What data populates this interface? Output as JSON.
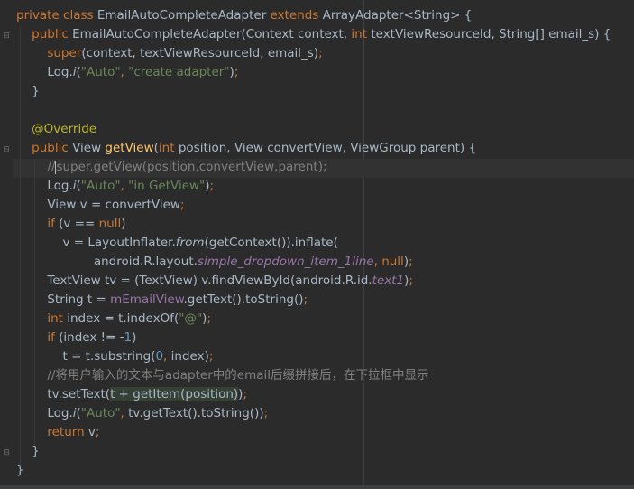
{
  "lines": [
    [
      {
        "t": "private class ",
        "c": "kw"
      },
      {
        "t": "EmailAutoCompleteAdapter "
      },
      {
        "t": "extends ",
        "c": "kw"
      },
      {
        "t": "ArrayAdapter<String> {"
      }
    ],
    [
      {
        "t": "    "
      },
      {
        "t": "public ",
        "c": "kw"
      },
      {
        "t": "EmailAutoCompleteAdapter(Context context, "
      },
      {
        "t": "int ",
        "c": "kw"
      },
      {
        "t": "textViewResourceId, String[] email_s) {"
      }
    ],
    [
      {
        "t": "        "
      },
      {
        "t": "super",
        "c": "kw"
      },
      {
        "t": "(context, textViewResourceId, email_s)"
      },
      {
        "t": ";",
        "c": "kw"
      }
    ],
    [
      {
        "t": "        Log."
      },
      {
        "t": "i",
        "c": "ital"
      },
      {
        "t": "("
      },
      {
        "t": "\"Auto\"",
        "c": "str"
      },
      {
        "t": ", ",
        "c": "kw"
      },
      {
        "t": "\"create adapter\"",
        "c": "str"
      },
      {
        "t": ")"
      },
      {
        "t": ";",
        "c": "kw"
      }
    ],
    [
      {
        "t": "    }"
      }
    ],
    [
      {
        "t": ""
      }
    ],
    [
      {
        "t": "    "
      },
      {
        "t": "@Override",
        "c": "ann"
      }
    ],
    [
      {
        "t": "    "
      },
      {
        "t": "public ",
        "c": "kw"
      },
      {
        "t": "View "
      },
      {
        "t": "getView",
        "c": "fn"
      },
      {
        "t": "("
      },
      {
        "t": "int ",
        "c": "kw"
      },
      {
        "t": "position, View convertView, ViewGroup parent) {"
      }
    ],
    [
      {
        "t": "        //",
        "c": "cmt"
      },
      {
        "t": "",
        "c": "caret"
      },
      {
        "t": "super.getView(position,convertView,parent);",
        "c": "cmt"
      }
    ],
    [
      {
        "t": "        Log."
      },
      {
        "t": "i",
        "c": "ital"
      },
      {
        "t": "("
      },
      {
        "t": "\"Auto\"",
        "c": "str"
      },
      {
        "t": ", ",
        "c": "kw"
      },
      {
        "t": "\"in GetView\"",
        "c": "str"
      },
      {
        "t": ")"
      },
      {
        "t": ";",
        "c": "kw"
      }
    ],
    [
      {
        "t": "        View v = convertView"
      },
      {
        "t": ";",
        "c": "kw"
      }
    ],
    [
      {
        "t": "        "
      },
      {
        "t": "if ",
        "c": "kw"
      },
      {
        "t": "(v == "
      },
      {
        "t": "null",
        "c": "kw"
      },
      {
        "t": ")"
      }
    ],
    [
      {
        "t": "            v = LayoutInflater."
      },
      {
        "t": "from",
        "c": "ital"
      },
      {
        "t": "(getContext()).inflate("
      }
    ],
    [
      {
        "t": "                    android.R.layout."
      },
      {
        "t": "simple_dropdown_item_1line",
        "c": "static"
      },
      {
        "t": ", ",
        "c": "kw"
      },
      {
        "t": "null",
        "c": "kw"
      },
      {
        "t": ")"
      },
      {
        "t": ";",
        "c": "kw"
      }
    ],
    [
      {
        "t": "        TextView tv = (TextView) v.findViewById(android.R.id."
      },
      {
        "t": "text1",
        "c": "static"
      },
      {
        "t": ")"
      },
      {
        "t": ";",
        "c": "kw"
      }
    ],
    [
      {
        "t": "        String t = "
      },
      {
        "t": "mEmailView",
        "c": "field"
      },
      {
        "t": ".getText().toString()"
      },
      {
        "t": ";",
        "c": "kw"
      }
    ],
    [
      {
        "t": "        "
      },
      {
        "t": "int ",
        "c": "kw"
      },
      {
        "t": "index = t.indexOf("
      },
      {
        "t": "\"@\"",
        "c": "str"
      },
      {
        "t": ")"
      },
      {
        "t": ";",
        "c": "kw"
      }
    ],
    [
      {
        "t": "        "
      },
      {
        "t": "if ",
        "c": "kw"
      },
      {
        "t": "(index != -"
      },
      {
        "t": "1",
        "c": "num"
      },
      {
        "t": ")"
      }
    ],
    [
      {
        "t": "            t = t.substring("
      },
      {
        "t": "0",
        "c": "num"
      },
      {
        "t": ", ",
        "c": "kw"
      },
      {
        "t": "index)"
      },
      {
        "t": ";",
        "c": "kw"
      }
    ],
    [
      {
        "t": "        //将用户输入的文本与adapter中的email后缀拼接后，在下拉框中显示",
        "c": "cmt"
      }
    ],
    [
      {
        "t": "        tv.setText("
      },
      {
        "t": "t + getItem(position)",
        "c": "hl"
      },
      {
        "t": ")"
      },
      {
        "t": ";",
        "c": "kw"
      }
    ],
    [
      {
        "t": "        Log."
      },
      {
        "t": "i",
        "c": "ital"
      },
      {
        "t": "("
      },
      {
        "t": "\"Auto\"",
        "c": "str"
      },
      {
        "t": ", ",
        "c": "kw"
      },
      {
        "t": "tv.getText().toString())"
      },
      {
        "t": ";",
        "c": "kw"
      }
    ],
    [
      {
        "t": "        "
      },
      {
        "t": "return ",
        "c": "kw"
      },
      {
        "t": "v"
      },
      {
        "t": ";",
        "c": "kw"
      }
    ],
    [
      {
        "t": "    }"
      }
    ],
    [
      {
        "t": "}"
      }
    ]
  ]
}
